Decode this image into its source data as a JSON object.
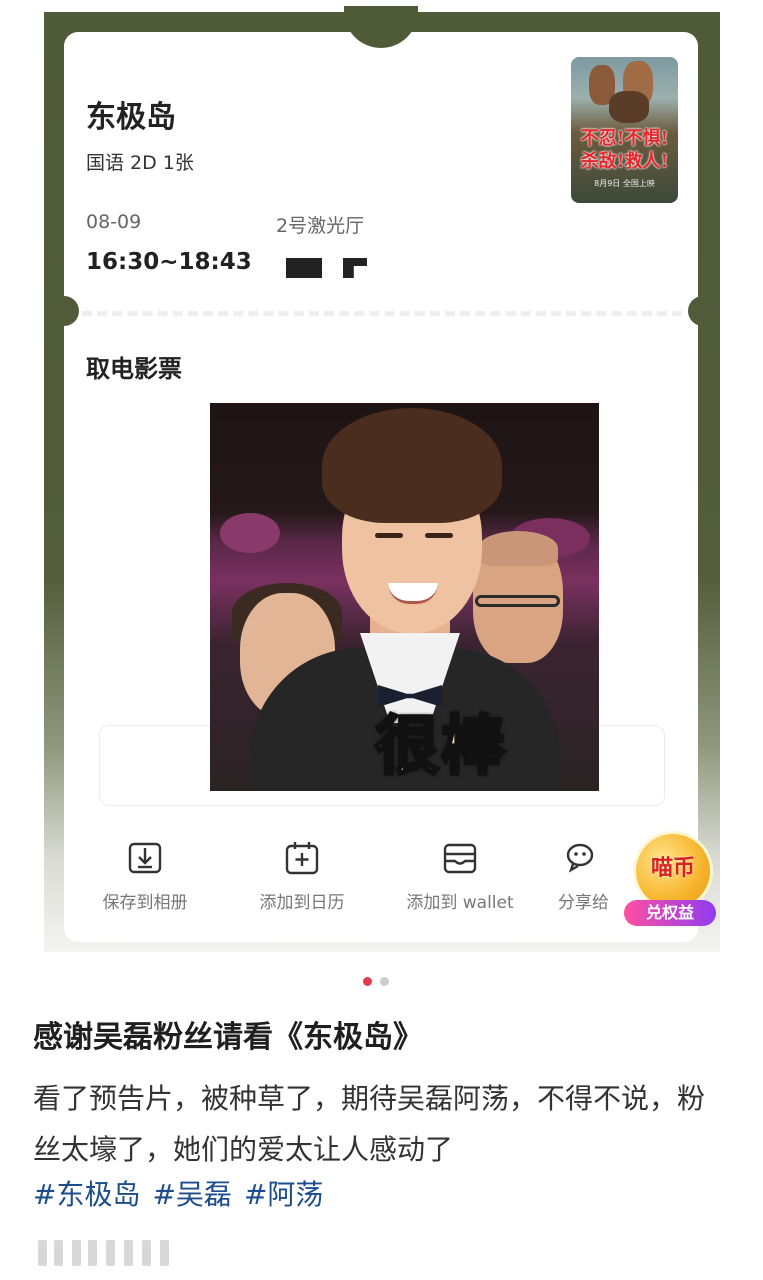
{
  "ticket": {
    "movie_title": "东极岛",
    "meta": "国语 2D 1张",
    "date": "08-09",
    "time": "16:30~18:43",
    "hall": "2号激光厅",
    "poster": {
      "text_line1": "不忍!不惧!",
      "text_line2": "杀敌!救人!",
      "subtitle": "8月9日 全国上映"
    },
    "section_title": "取电影票"
  },
  "sticker": {
    "caption": "很棒"
  },
  "actions": [
    {
      "label": "保存到相册",
      "icon": "download-icon"
    },
    {
      "label": "添加到日历",
      "icon": "calendar-add-icon"
    },
    {
      "label": "添加到 wallet",
      "icon": "wallet-icon"
    },
    {
      "label": "分享给",
      "icon": "wechat-icon"
    }
  ],
  "coin": {
    "title": "喵币",
    "badge": "兑权益"
  },
  "pager": {
    "active_color": "#e8394a",
    "inactive_color": "#cccccc"
  },
  "post": {
    "title": "感谢吴磊粉丝请看《东极岛》",
    "body": "看了预告片，被种草了，期待吴磊阿荡，不得不说，粉丝太壕了，她们的爱太让人感动了",
    "tags": [
      "#东极岛",
      "#吴磊",
      "#阿荡"
    ]
  },
  "colors": {
    "frame": "#4f5a37",
    "tag": "#1d4d8c"
  }
}
